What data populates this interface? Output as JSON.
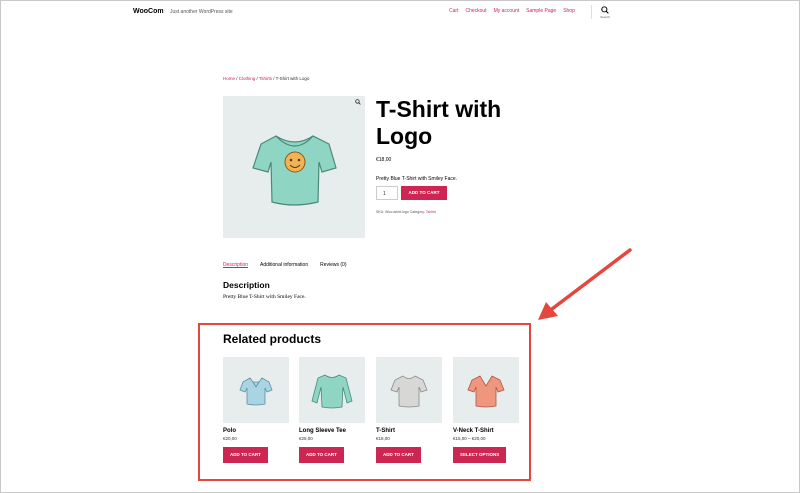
{
  "header": {
    "site_title": "WooCom",
    "tagline": "Just another WordPress site",
    "nav": [
      "Cart",
      "Checkout",
      "My account",
      "Sample Page",
      "Shop"
    ],
    "search_label": "Search"
  },
  "breadcrumb": {
    "items": [
      "Home",
      "Clothing",
      "Tshirts"
    ],
    "separator": " / ",
    "current": "T-Shirt with Logo"
  },
  "product": {
    "title": "T-Shirt with Logo",
    "price": "€18,00",
    "short_description": "Pretty Blue T-Shirt with Smiley Face.",
    "quantity": "1",
    "add_to_cart": "ADD TO CART",
    "meta_prefix": "SKU: Woo-tshirt-logo Category: ",
    "category": "Tshirts"
  },
  "tabs": {
    "items": [
      "Description",
      "Additional information",
      "Reviews (0)"
    ],
    "description_heading": "Description",
    "description_text": "Pretty Blue T-Shirt with Smiley Face."
  },
  "related": {
    "heading": "Related products",
    "products": [
      {
        "name": "Polo",
        "price": "€20,00",
        "button": "ADD TO CART",
        "color": "#a9d4e4"
      },
      {
        "name": "Long Sleeve Tee",
        "price": "€25,00",
        "button": "ADD TO CART",
        "color": "#8fd5c4"
      },
      {
        "name": "T-Shirt",
        "price": "€18,00",
        "button": "ADD TO CART",
        "color": "#d7d7d5"
      },
      {
        "name": "V-Neck T-Shirt",
        "price": "€15,00 – €20,00",
        "button": "SELECT OPTIONS",
        "color": "#f0957e"
      }
    ]
  },
  "colors": {
    "accent": "#cd2653",
    "highlight_box": "#e5473e",
    "image_background": "#e7eded",
    "main_tshirt": "#8fd5c4"
  }
}
